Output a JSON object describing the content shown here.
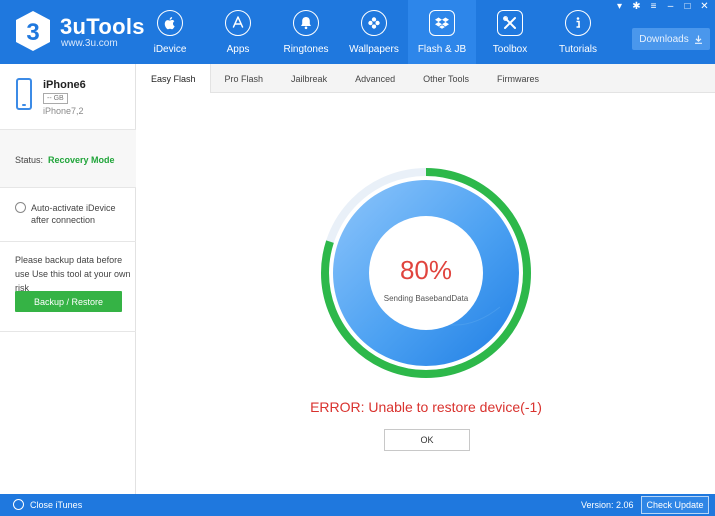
{
  "app": {
    "name": "3uTools",
    "url": "www.3u.com",
    "logo_digit": "3"
  },
  "nav": {
    "items": [
      {
        "label": "iDevice",
        "icon": "apple-icon"
      },
      {
        "label": "Apps",
        "icon": "app-store-icon"
      },
      {
        "label": "Ringtones",
        "icon": "bell-icon"
      },
      {
        "label": "Wallpapers",
        "icon": "flower-icon"
      },
      {
        "label": "Flash & JB",
        "icon": "dropbox-box-icon"
      },
      {
        "label": "Toolbox",
        "icon": "wrench-screwdriver-icon"
      },
      {
        "label": "Tutorials",
        "icon": "info-icon"
      }
    ],
    "active": "Flash & JB"
  },
  "window_controls": [
    "▾",
    "✱",
    "≡",
    "–",
    "□",
    "✕"
  ],
  "downloads": {
    "label": "Downloads"
  },
  "device": {
    "name": "iPhone6",
    "capacity": "-- GB",
    "model": "iPhone7,2"
  },
  "status": {
    "label": "Status:",
    "value": "Recovery Mode"
  },
  "auto_activate": {
    "label": "Auto-activate iDevice after connection"
  },
  "backup": {
    "note": "Please backup data before use Use this tool at your own risk",
    "button": "Backup / Restore"
  },
  "tabs": [
    {
      "label": "Easy Flash",
      "active": true
    },
    {
      "label": "Pro Flash",
      "active": false
    },
    {
      "label": "Jailbreak",
      "active": false
    },
    {
      "label": "Advanced",
      "active": false
    },
    {
      "label": "Other Tools",
      "active": false
    },
    {
      "label": "Firmwares",
      "active": false
    }
  ],
  "progress": {
    "percent_label": "80%",
    "fraction": 0.8,
    "status_text": "Sending BasebandData"
  },
  "error": {
    "message": "ERROR: Unable to restore device(-1)",
    "ok_label": "OK"
  },
  "footer": {
    "close_itunes": "Close iTunes",
    "version": "Version: 2.06",
    "check_update": "Check Update"
  },
  "colors": {
    "brand_blue": "#1f78de",
    "progress_green": "#2db84a",
    "error_red": "#d9322e",
    "status_green": "#20a53a"
  }
}
